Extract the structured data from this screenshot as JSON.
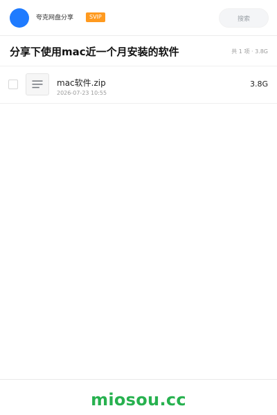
{
  "header": {
    "brand_label": "夸克网盘分享",
    "badge_label": "SVIP",
    "search_placeholder": "搜索"
  },
  "share": {
    "title": "分享下使用mac近一个月安装的软件",
    "meta": "共 1 项 · 3.8G"
  },
  "files": [
    {
      "name": "mac软件.zip",
      "date": "2026-07-23 10:55",
      "size": "3.8G",
      "icon": "archive-file-icon"
    }
  ],
  "footer": {
    "watermark": "miosou.cc"
  },
  "colors": {
    "avatar": "#1f7bff",
    "badge": "#ff9a1f",
    "watermark": "#27b14f"
  }
}
